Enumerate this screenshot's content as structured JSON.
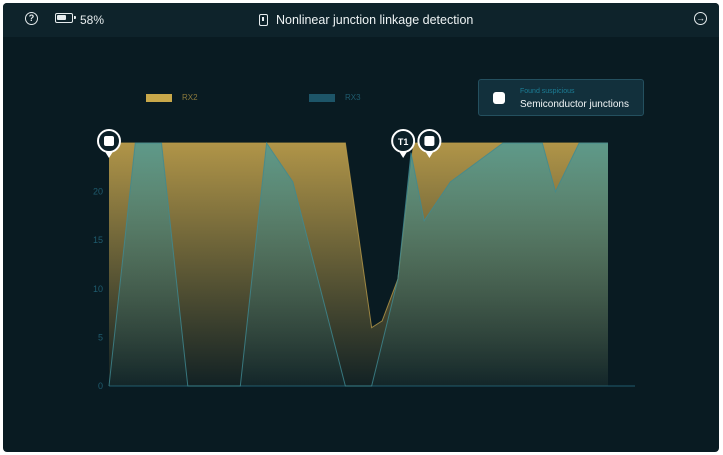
{
  "status": {
    "battery_percent": "58%"
  },
  "header": {
    "title": "Nonlinear junction linkage detection"
  },
  "legend": [
    {
      "name": "RX2",
      "color": "#c8a84a"
    },
    {
      "name": "RX3",
      "color": "#1d5568"
    }
  ],
  "info_card": {
    "caption": "Found suspicious",
    "label": "Semiconductor junctions"
  },
  "colors": {
    "background": "#091b22",
    "rx2": "#b89a48",
    "rx3": "#3f8a92",
    "axis": "#1f5b6e",
    "marker": "#ffffff"
  },
  "chart_data": {
    "type": "area",
    "y_ticks": [
      "0",
      "5",
      "10",
      "15",
      "20"
    ],
    "ylim": [
      0,
      25
    ],
    "xlim": [
      0,
      20
    ],
    "series": [
      {
        "name": "RX2",
        "x": [
          0,
          0.9,
          1.5,
          2.1,
          3,
          4,
          6,
          6.7,
          9,
          10,
          10.4,
          11,
          11.6,
          12,
          13.5,
          15,
          16,
          17,
          17.9,
          19
        ],
        "y": [
          25,
          25,
          25,
          25,
          25,
          25,
          25,
          25,
          25,
          6,
          6.7,
          11,
          25,
          25,
          25,
          25,
          25,
          25,
          25,
          25
        ]
      },
      {
        "name": "RX3",
        "x": [
          0,
          1,
          2,
          3,
          5,
          6,
          7,
          9,
          10,
          11,
          11.5,
          12,
          13,
          15,
          16.5,
          17,
          17.9,
          19
        ],
        "y": [
          0,
          25,
          25,
          0,
          0,
          25,
          21,
          0,
          0,
          11,
          24,
          17,
          21,
          25,
          25,
          20,
          25,
          25
        ]
      }
    ],
    "markers": [
      {
        "x": 0,
        "label": ""
      },
      {
        "x": 11.2,
        "label": "T1"
      },
      {
        "x": 12.2,
        "label": ""
      }
    ]
  }
}
